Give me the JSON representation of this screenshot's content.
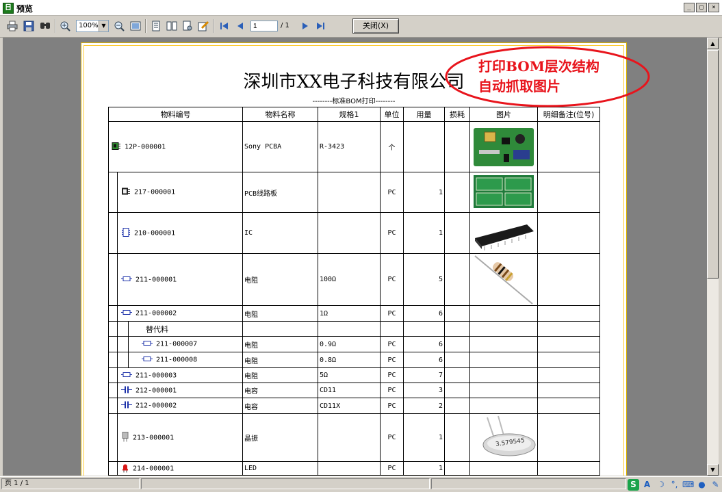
{
  "window": {
    "title": "预览",
    "app_icon": "日"
  },
  "toolbar": {
    "zoom": "100%",
    "page_current": "1",
    "page_total": "/ 1",
    "close_label": "关闭(X)"
  },
  "report": {
    "company": "深圳市XX电子科技有限公司",
    "subtitle": "--------标准BOM打印--------",
    "callout_line1": "打印BOM层次结构",
    "callout_line2": "自动抓取图片",
    "callout_color": "#e8141c",
    "columns": [
      "物料编号",
      "物料名称",
      "规格1",
      "单位",
      "用量",
      "损耗",
      "图片",
      "明细备注(位号)"
    ],
    "rows": [
      {
        "level": 0,
        "icon": "pcba-icon",
        "code": "12P-000001",
        "name": "Sony PCBA",
        "spec": "R-3423",
        "unit": "个",
        "qty": "",
        "image": "pcba-photo"
      },
      {
        "level": 1,
        "icon": "pcb-board-icon",
        "code": "217-000001",
        "name": "PCB线路板",
        "spec": "",
        "unit": "PC",
        "qty": "1",
        "image": "pcb-photo"
      },
      {
        "level": 1,
        "icon": "ic-chip-icon",
        "code": "210-000001",
        "name": "IC",
        "spec": "",
        "unit": "PC",
        "qty": "1",
        "image": "ic-photo"
      },
      {
        "level": 1,
        "icon": "resistor-icon",
        "code": "211-000001",
        "name": "电阻",
        "spec": "100Ω",
        "unit": "PC",
        "qty": "5",
        "image": "resistor-photo"
      },
      {
        "level": 1,
        "icon": "resistor-icon",
        "code": "211-000002",
        "name": "电阻",
        "spec": "1Ω",
        "unit": "PC",
        "qty": "6",
        "image": ""
      },
      {
        "level": 2,
        "icon": "",
        "code": "替代料",
        "name": "",
        "spec": "",
        "unit": "",
        "qty": "",
        "image": "",
        "group": true
      },
      {
        "level": 3,
        "icon": "resistor-icon",
        "code": "211-000007",
        "name": "电阻",
        "spec": "0.9Ω",
        "unit": "PC",
        "qty": "6",
        "image": ""
      },
      {
        "level": 3,
        "icon": "resistor-icon",
        "code": "211-000008",
        "name": "电阻",
        "spec": "0.8Ω",
        "unit": "PC",
        "qty": "6",
        "image": ""
      },
      {
        "level": 1,
        "icon": "resistor-icon",
        "code": "211-000003",
        "name": "电阻",
        "spec": "5Ω",
        "unit": "PC",
        "qty": "7",
        "image": ""
      },
      {
        "level": 1,
        "icon": "capacitor-icon",
        "code": "212-000001",
        "name": "电容",
        "spec": "CD11",
        "unit": "PC",
        "qty": "3",
        "image": ""
      },
      {
        "level": 1,
        "icon": "capacitor-icon",
        "code": "212-000002",
        "name": "电容",
        "spec": "CD11X",
        "unit": "PC",
        "qty": "2",
        "image": ""
      },
      {
        "level": 1,
        "icon": "crystal-icon",
        "code": "213-000001",
        "name": "晶振",
        "spec": "",
        "unit": "PC",
        "qty": "1",
        "image": "crystal-photo",
        "photo_label": "3.579545"
      },
      {
        "level": 1,
        "icon": "led-icon",
        "code": "214-000001",
        "name": "LED",
        "spec": "",
        "unit": "PC",
        "qty": "1",
        "image": ""
      }
    ]
  },
  "status": {
    "page_info": "页 1 / 1"
  },
  "tray_icons": [
    "sogou-icon",
    "ime-a-icon",
    "moon-icon",
    "punctuation-icon",
    "keyboard-icon",
    "user-icon",
    "wrench-icon"
  ]
}
